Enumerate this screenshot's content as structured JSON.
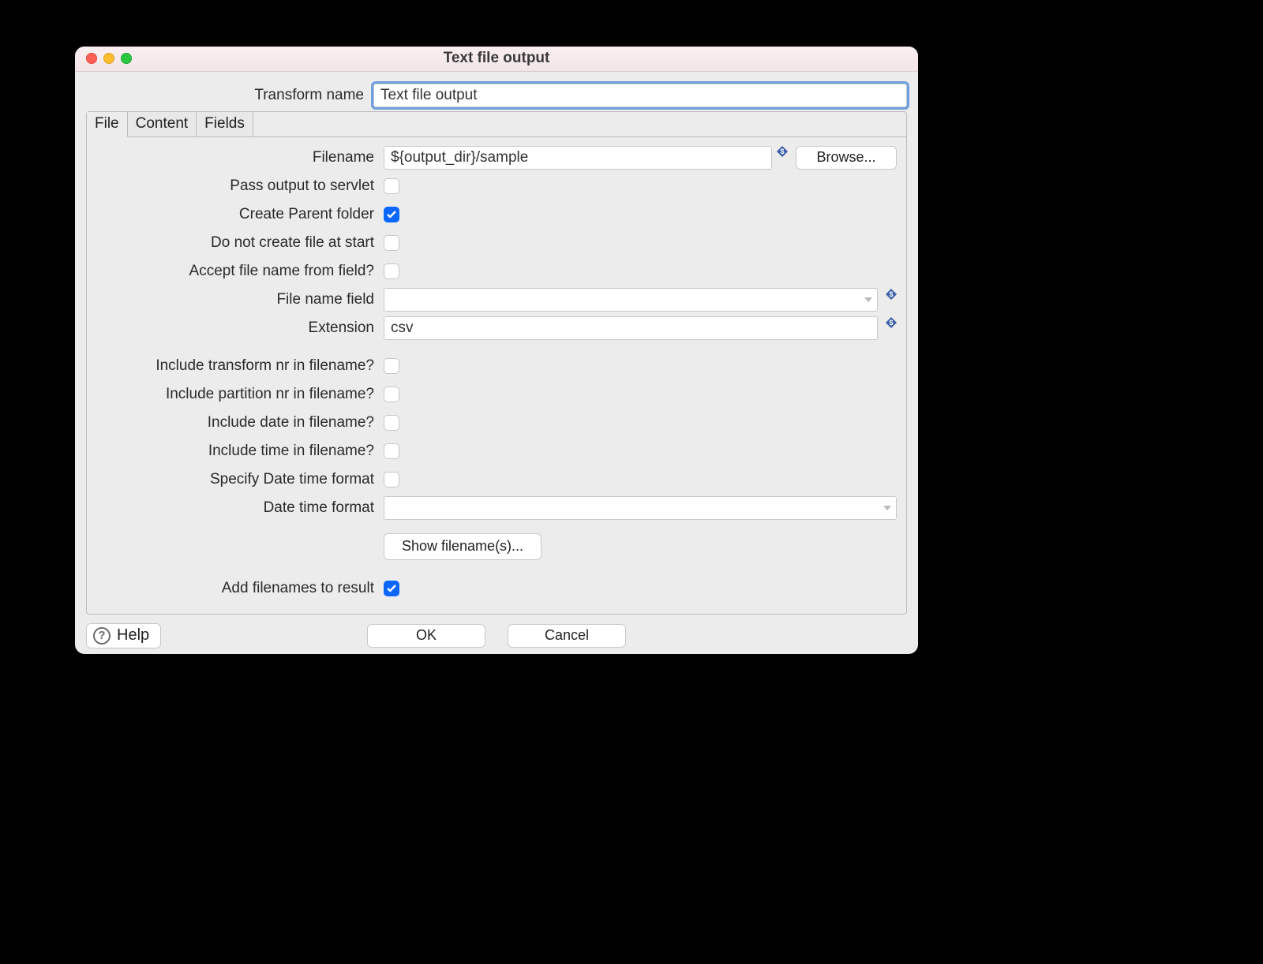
{
  "window": {
    "title": "Text file output"
  },
  "transform": {
    "label": "Transform name",
    "value": "Text file output"
  },
  "tabs": {
    "file": "File",
    "content": "Content",
    "fields": "Fields",
    "active": "file"
  },
  "file_tab": {
    "filename_label": "Filename",
    "filename_value": "${output_dir}/sample",
    "browse_label": "Browse...",
    "pass_servlet_label": "Pass output to servlet",
    "pass_servlet_checked": false,
    "create_parent_label": "Create Parent folder",
    "create_parent_checked": true,
    "no_create_start_label": "Do not create file at start",
    "no_create_start_checked": false,
    "accept_from_field_label": "Accept file name from field?",
    "accept_from_field_checked": false,
    "filename_field_label": "File name field",
    "filename_field_value": "",
    "extension_label": "Extension",
    "extension_value": "csv",
    "inc_transform_nr_label": "Include transform nr in filename?",
    "inc_transform_nr_checked": false,
    "inc_partition_nr_label": "Include partition nr in filename?",
    "inc_partition_nr_checked": false,
    "inc_date_label": "Include date in filename?",
    "inc_date_checked": false,
    "inc_time_label": "Include time in filename?",
    "inc_time_checked": false,
    "specify_dtf_label": "Specify Date time format",
    "specify_dtf_checked": false,
    "dtf_label": "Date time format",
    "dtf_value": "",
    "show_filenames_label": "Show filename(s)...",
    "add_result_label": "Add filenames to result",
    "add_result_checked": true
  },
  "footer": {
    "help_label": "Help",
    "ok_label": "OK",
    "cancel_label": "Cancel"
  }
}
